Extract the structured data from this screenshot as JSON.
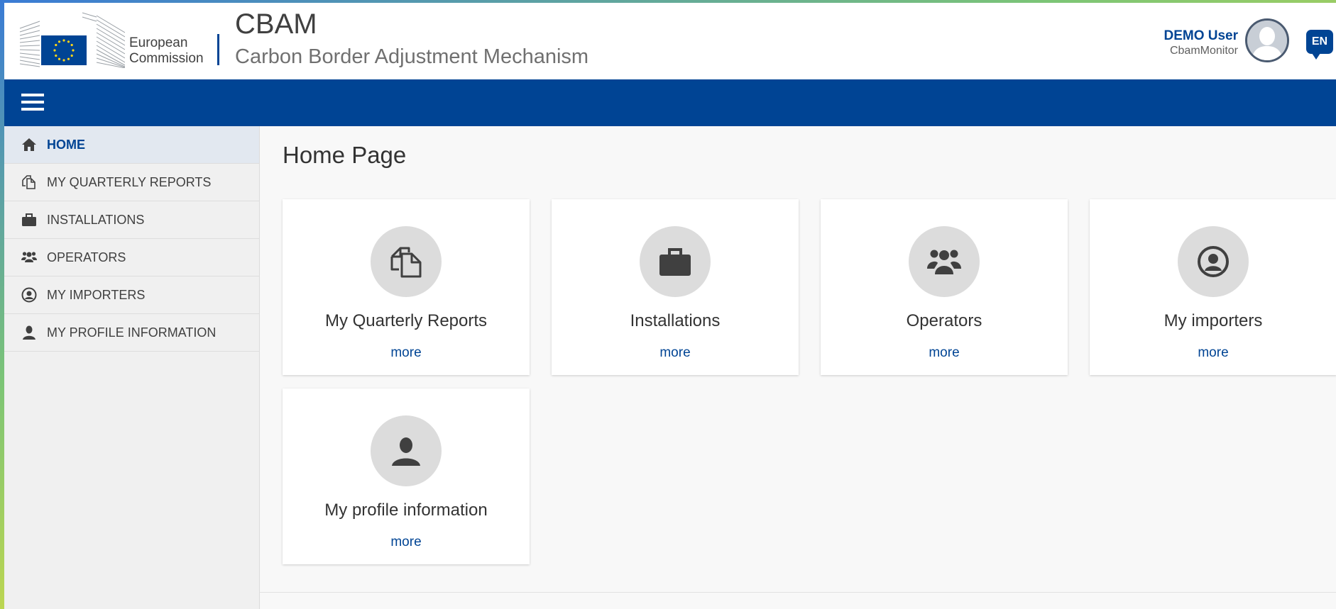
{
  "logo": {
    "line1": "European",
    "line2": "Commission"
  },
  "app": {
    "title": "CBAM",
    "subtitle": "Carbon Border Adjustment Mechanism"
  },
  "user": {
    "name": "DEMO User",
    "role": "CbamMonitor",
    "language": "EN"
  },
  "colors": {
    "brand_blue": "#004494",
    "sidebar_bg": "#f0f0f0",
    "active_bg": "#e2e8f0"
  },
  "sidebar": {
    "items": [
      {
        "label": "HOME",
        "icon": "home-icon"
      },
      {
        "label": "MY QUARTERLY REPORTS",
        "icon": "documents-icon"
      },
      {
        "label": "INSTALLATIONS",
        "icon": "briefcase-icon"
      },
      {
        "label": "OPERATORS",
        "icon": "users-icon"
      },
      {
        "label": "MY IMPORTERS",
        "icon": "user-circle-icon"
      },
      {
        "label": "MY PROFILE INFORMATION",
        "icon": "user-icon"
      }
    ]
  },
  "main": {
    "page_title": "Home Page",
    "cards": [
      {
        "title": "My Quarterly Reports",
        "more": "more",
        "icon": "documents-icon"
      },
      {
        "title": "Installations",
        "more": "more",
        "icon": "briefcase-icon"
      },
      {
        "title": "Operators",
        "more": "more",
        "icon": "users-icon"
      },
      {
        "title": "My importers",
        "more": "more",
        "icon": "user-circle-icon"
      },
      {
        "title": "My profile information",
        "more": "more",
        "icon": "user-icon"
      }
    ]
  }
}
